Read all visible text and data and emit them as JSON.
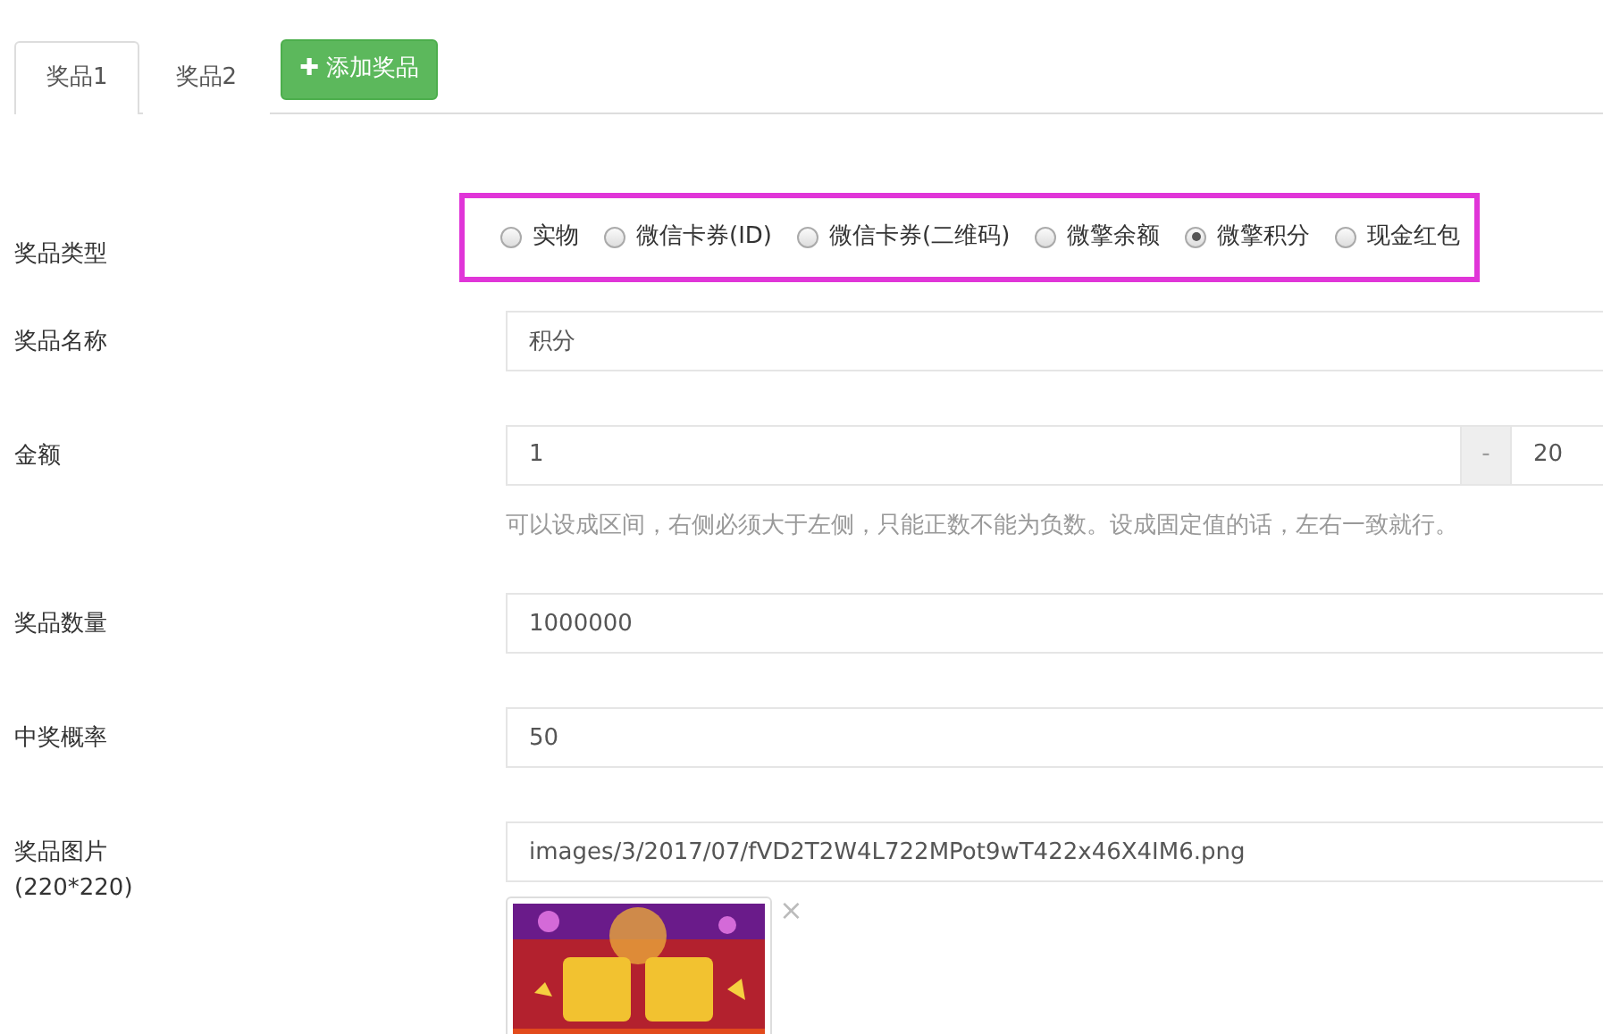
{
  "tabs": [
    {
      "label": "奖品1",
      "selected": true
    },
    {
      "label": "奖品2",
      "selected": false
    }
  ],
  "add_button": {
    "icon": "✚",
    "label": "添加奖品"
  },
  "prize_type": {
    "label": "奖品类型",
    "highlighted": true,
    "options": [
      {
        "label": "实物",
        "selected": false
      },
      {
        "label": "微信卡券(ID)",
        "selected": false
      },
      {
        "label": "微信卡券(二维码)",
        "selected": false
      },
      {
        "label": "微擎余额",
        "selected": false
      },
      {
        "label": "微擎积分",
        "selected": true
      },
      {
        "label": "现金红包",
        "selected": false
      }
    ]
  },
  "prize_name": {
    "label": "奖品名称",
    "value": "积分"
  },
  "amount": {
    "label": "金额",
    "min": "1",
    "separator": "-",
    "max": "20",
    "help": "可以设成区间，右侧必须大于左侧，只能正数不能为负数。设成固定值的话，左右一致就行。"
  },
  "quantity": {
    "label": "奖品数量",
    "value": "1000000"
  },
  "probability": {
    "label": "中奖概率",
    "value": "50"
  },
  "image": {
    "label": "奖品图片",
    "size_note": "(220*220)",
    "value": "images/3/2017/07/fVD2T2W4L722MPot9wT422x46X4IM6.png",
    "remove": "×"
  }
}
